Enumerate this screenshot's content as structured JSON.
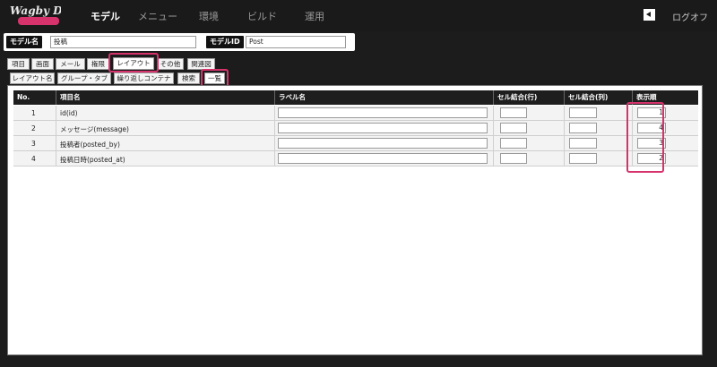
{
  "nav": {
    "logo_text": "Wagby Designer",
    "items": [
      "モデル",
      "メニュー",
      "環境",
      "ビルド",
      "運用"
    ],
    "logout_label": "ログオフ"
  },
  "model_bar": {
    "name_label": "モデル名",
    "name_value": "投稿",
    "id_label": "モデルID",
    "id_value": "Post"
  },
  "main_tabs": [
    "項目",
    "画面",
    "メール",
    "権限",
    "レイアウト",
    "その他",
    "関連図"
  ],
  "sub_tabs": [
    "レイアウト名",
    "グループ・タブ",
    "繰り返しコンテナ",
    "検索",
    "一覧"
  ],
  "table": {
    "headers": [
      "No.",
      "項目名",
      "ラベル名",
      "セル結合(行)",
      "セル結合(列)",
      "表示順"
    ],
    "rows": [
      {
        "no": "1",
        "item": "id(id)",
        "label": "",
        "row_merge": "",
        "col_merge": "",
        "order": "1"
      },
      {
        "no": "2",
        "item": "メッセージ(message)",
        "label": "",
        "row_merge": "",
        "col_merge": "",
        "order": "4"
      },
      {
        "no": "3",
        "item": "投稿者(posted_by)",
        "label": "",
        "row_merge": "",
        "col_merge": "",
        "order": "3"
      },
      {
        "no": "4",
        "item": "投稿日時(posted_at)",
        "label": "",
        "row_merge": "",
        "col_merge": "",
        "order": "2"
      }
    ]
  },
  "colors": {
    "highlight": "#d6336c",
    "nav_bg": "#1a1a1a",
    "header_bg": "#1e1e1e"
  }
}
